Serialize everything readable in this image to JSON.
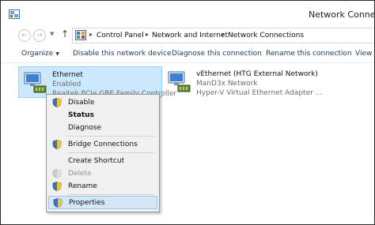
{
  "window": {
    "title": "Network Connect"
  },
  "address_bar": {
    "crumbs": [
      "Control Panel",
      "Network and Internet",
      "Network Connections"
    ]
  },
  "toolbar": {
    "organize": "Organize",
    "disable": "Disable this network device",
    "diagnose": "Diagnose this connection",
    "rename": "Rename this connection",
    "view": "View s"
  },
  "connections": [
    {
      "name": "Ethernet",
      "status": "Enabled",
      "adapter": "Realtek PCIe GBE Family Controller",
      "selected": true
    },
    {
      "name": "vEthernet (HTG External Network)",
      "status": "ManD3x Network",
      "adapter": "Hyper-V Virtual Ethernet Adapter ..."
    }
  ],
  "context_menu": {
    "items": [
      {
        "label": "Disable",
        "icon": "uac-shield-icon"
      },
      {
        "label": "Status",
        "default": true
      },
      {
        "label": "Diagnose"
      },
      {
        "label": "Bridge Connections",
        "icon": "uac-shield-icon"
      },
      {
        "label": "Create Shortcut"
      },
      {
        "label": "Delete",
        "icon": "uac-shield-icon",
        "disabled": true
      },
      {
        "label": "Rename",
        "icon": "uac-shield-icon"
      },
      {
        "label": "Properties",
        "icon": "uac-shield-icon",
        "highlighted": true
      }
    ]
  },
  "colors": {
    "selection_bg": "#cce8ff",
    "toolbar_text": "#1c3a57",
    "menu_bg": "#f0f0f0"
  }
}
